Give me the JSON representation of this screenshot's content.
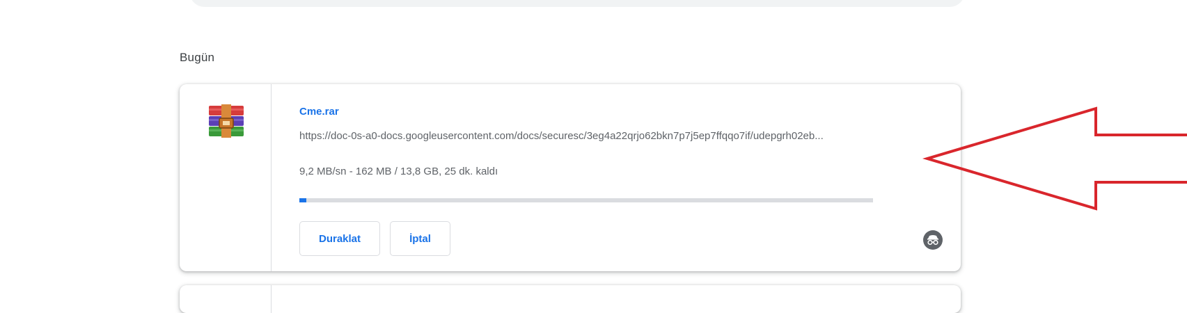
{
  "section": {
    "date_label": "Bugün"
  },
  "download": {
    "file_name": "Cme.rar",
    "url": "https://doc-0s-a0-docs.googleusercontent.com/docs/securesc/3eg4a22qrjo62bkn7p7j5ep7ffqqo7if/udepgrh02eb...",
    "status": "9,2 MB/sn - 162 MB / 13,8 GB, 25 dk. kaldı",
    "progress_fraction": 0.012,
    "file_icon": "winrar-archive-icon",
    "pause_label": "Duraklat",
    "cancel_label": "İptal",
    "incognito_icon": "incognito-icon"
  },
  "colors": {
    "accent": "#1a73e8",
    "annotation_arrow": "#d9262c"
  }
}
